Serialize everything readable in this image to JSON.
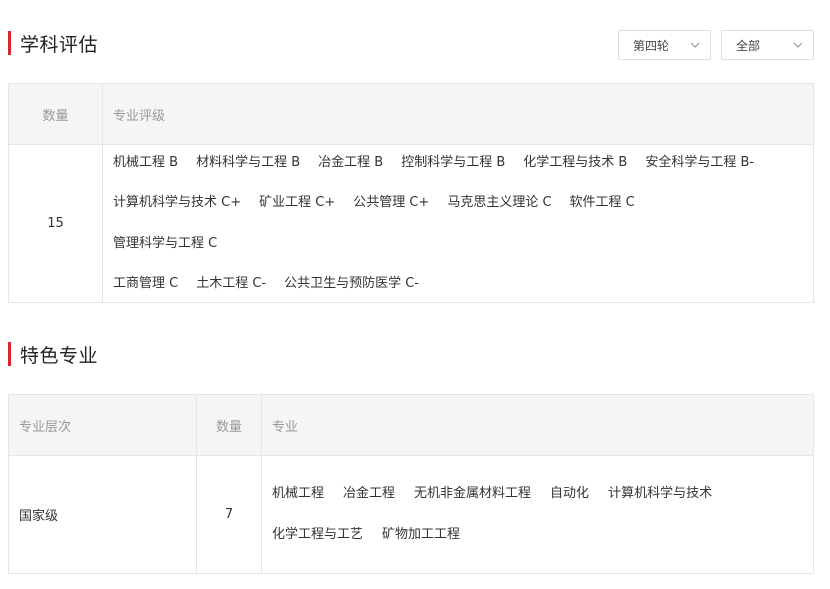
{
  "evaluation": {
    "title": "学科评估",
    "round_select": "第四轮",
    "scope_select": "全部",
    "headers": {
      "count": "数量",
      "grades": "专业评级"
    },
    "count": "15",
    "items": [
      "机械工程 B",
      "材料科学与工程 B",
      "冶金工程 B",
      "控制科学与工程 B",
      "化学工程与技术 B",
      "安全科学与工程 B-",
      "计算机科学与技术 C+",
      "矿业工程 C+",
      "公共管理 C+",
      "马克思主义理论 C",
      "软件工程 C",
      "管理科学与工程 C",
      "工商管理 C",
      "土木工程 C-",
      "公共卫生与预防医学 C-"
    ]
  },
  "special": {
    "title": "特色专业",
    "headers": {
      "level": "专业层次",
      "count": "数量",
      "majors": "专业"
    },
    "level": "国家级",
    "count": "7",
    "items": [
      "机械工程",
      "冶金工程",
      "无机非金属材料工程",
      "自动化",
      "计算机科学与技术",
      "化学工程与工艺",
      "矿物加工工程"
    ]
  },
  "colors": {
    "accent": "#d9262c",
    "header_bg": "#f5f5f5",
    "border": "#e6e6e6"
  },
  "icons": {
    "select": "chevron-down-icon"
  }
}
